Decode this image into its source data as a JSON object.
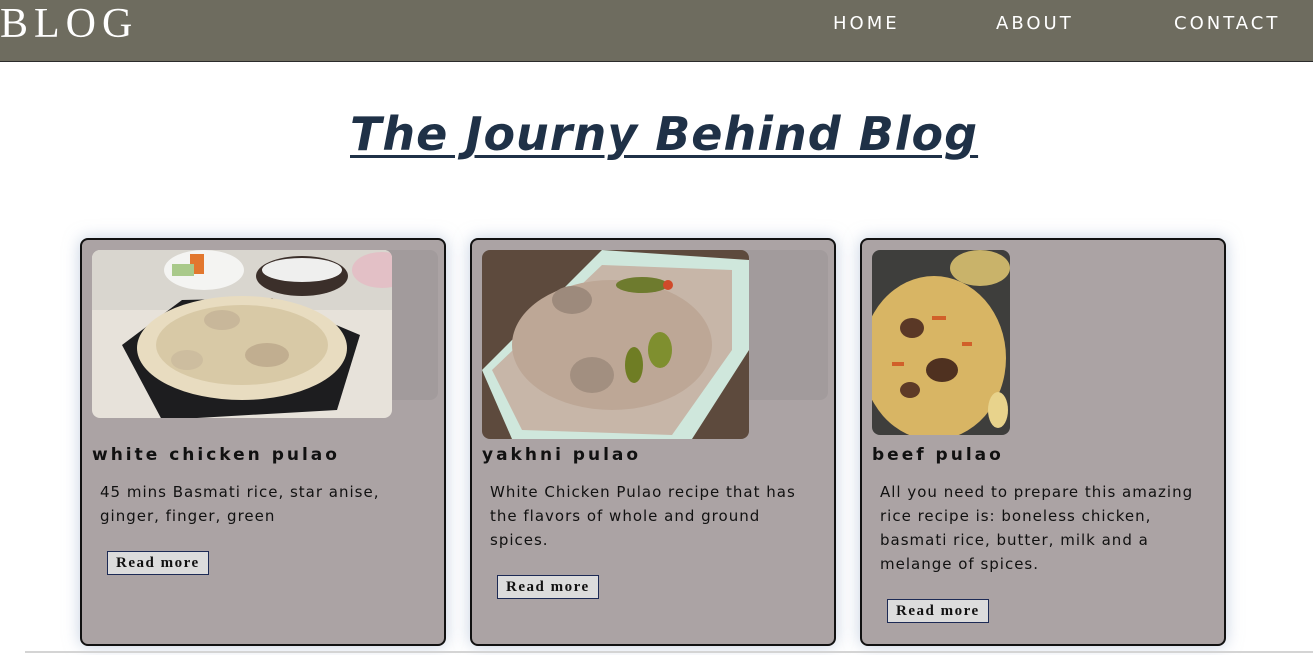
{
  "nav": {
    "logo": "BLOG",
    "links": [
      "HOME",
      "ABOUT",
      "CONTACT"
    ]
  },
  "hero": {
    "title": "The Journy Behind Blog"
  },
  "cards": [
    {
      "title": "white chicken pulao",
      "text": "45 mins Basmati rice, star anise, ginger, finger, green",
      "button": "Read more",
      "image": "white-chicken-pulao-photo"
    },
    {
      "title": "yakhni pulao",
      "text": "White Chicken Pulao recipe that has the flavors of whole and ground spices.",
      "button": "Read more",
      "image": "yakhni-pulao-photo"
    },
    {
      "title": "beef pulao",
      "text": "All you need to prepare this amazing rice recipe is: boneless chicken, basmati rice, butter, milk and a melange of spices.",
      "button": "Read more",
      "image": "beef-pulao-photo"
    }
  ],
  "colors": {
    "navbar": "#6e6c5f",
    "title": "#1f3147",
    "card": "#aba3a4",
    "button": "#dcdcdc"
  }
}
